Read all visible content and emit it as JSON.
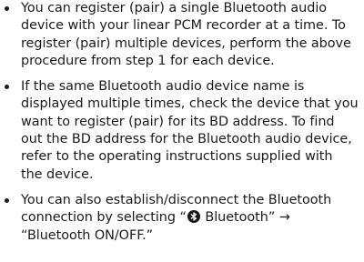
{
  "notes": [
    {
      "lines": [
        "You can register (pair) a single Bluetooth audio",
        "device with your linear PCM recorder at a time. To",
        "register (pair) multiple devices, perform the above",
        "procedure from step 1 for each device."
      ]
    },
    {
      "lines": [
        "If the same Bluetooth audio device name is",
        "displayed multiple times, check the device that you",
        "want to register (pair) for its BD address. To find",
        "out the BD address for the Bluetooth audio device,",
        "refer to the operating instructions supplied with",
        "the device."
      ]
    },
    {
      "lines": [
        "You can also establish/disconnect the Bluetooth"
      ],
      "line2_before_icon": "connection by selecting “",
      "icon": "bluetooth-icon",
      "line2_after_icon": " Bluetooth” →",
      "line3": "“Bluetooth ON/OFF.”"
    }
  ]
}
